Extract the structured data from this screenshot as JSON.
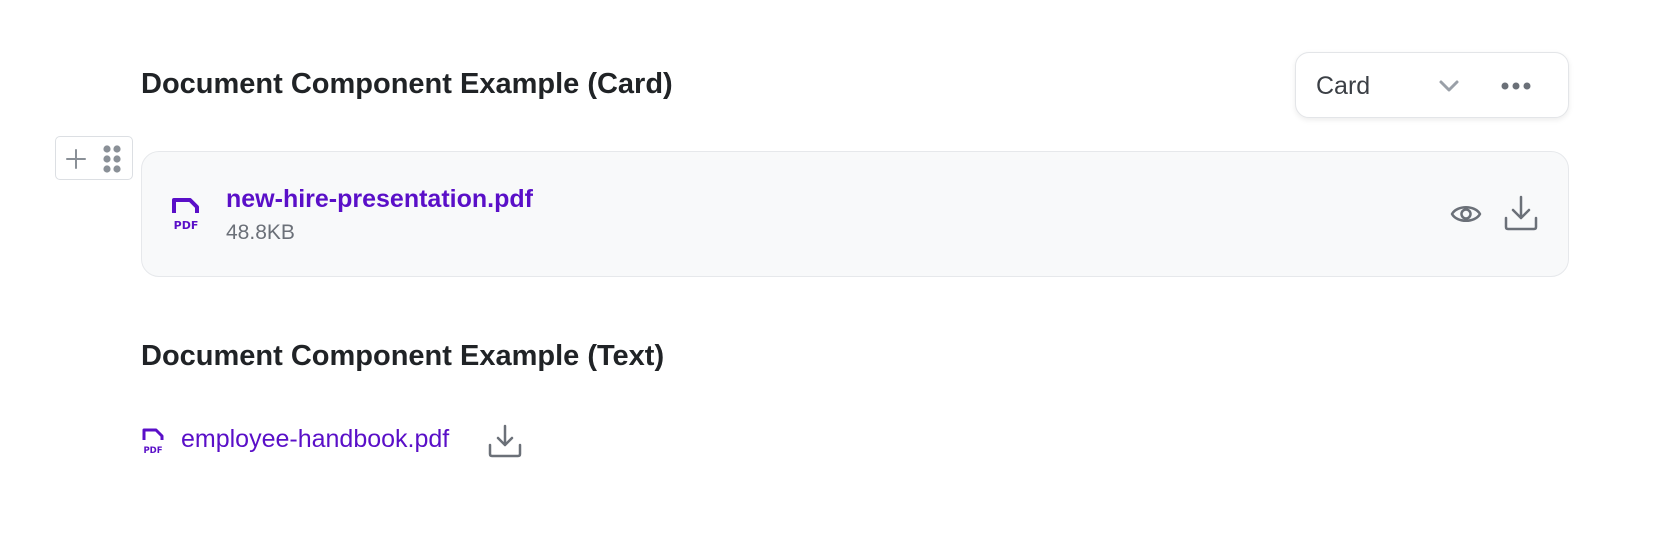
{
  "sections": {
    "card": {
      "title": "Document Component Example (Card)",
      "file_name": "new-hire-presentation.pdf",
      "file_size": "48.8KB"
    },
    "text": {
      "title": "Document Component Example (Text)",
      "file_name": "employee-handbook.pdf"
    }
  },
  "view_select": {
    "value": "Card"
  },
  "icons": {
    "pdf": "pdf-file-icon",
    "preview": "eye-icon",
    "download": "download-icon",
    "dropdown": "chevron-down-icon",
    "more": "more-horizontal-icon",
    "add": "plus-icon",
    "drag": "drag-handle-icon"
  },
  "colors": {
    "link": "#5a0fc8",
    "icon": "#6b7078",
    "card_bg": "#f8f9fa"
  }
}
